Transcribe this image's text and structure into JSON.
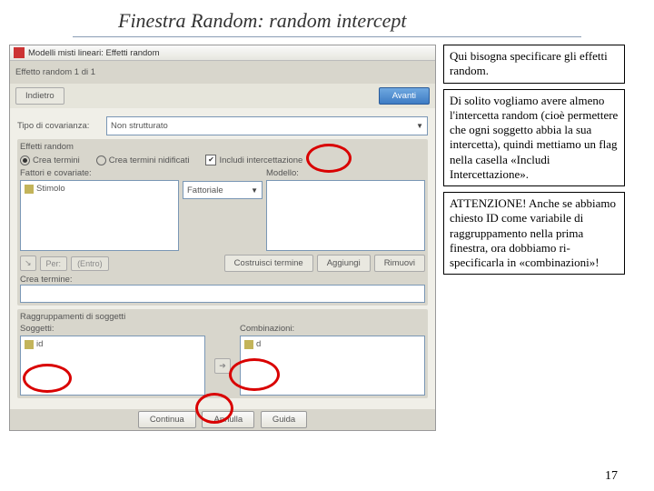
{
  "title": "Finestra Random: random intercept",
  "page_number": "17",
  "app": {
    "window_title": "Modelli misti lineari: Effetti random",
    "dialog_label": "Effetto random 1 di 1",
    "back_btn": "Indietro",
    "forward_btn": "Avanti",
    "cov_label": "Tipo di covarianza:",
    "cov_value": "Non strutturato",
    "section_effects": "Effetti random",
    "radio_create": "Crea termini",
    "radio_nested": "Crea termini nidificati",
    "chk_intercept": "Includi intercettazione",
    "factors_label": "Fattori e covariate:",
    "model_label": "Modello:",
    "factor_item": "Stimolo",
    "interaction": "Fattoriale",
    "btn_per": "Per:",
    "btn_entro": "(Entro)",
    "btn_costruisci": "Costruisci termine",
    "btn_aggiungi": "Aggiungi",
    "btn_rimuovi": "Rimuovi",
    "crea_label": "Crea termine:",
    "section_grouping": "Raggruppamenti di soggetti",
    "subjects_label": "Soggetti:",
    "combos_label": "Combinazioni:",
    "id_item": "id",
    "continua": "Continua",
    "annulla": "Annulla",
    "guida": "Guida"
  },
  "notes": {
    "n1": "Qui bisogna specificare gli effetti random.",
    "n2": "Di solito vogliamo avere almeno l'intercetta random (cioè permettere che ogni soggetto abbia la sua intercetta), quindi mettiamo un flag nella casella «Includi Intercettazione».",
    "n3": "ATTENZIONE! Anche se abbiamo chiesto ID come variabile di raggruppamento nella prima finestra, ora dobbiamo ri-specificarla in «combinazioni»!"
  }
}
